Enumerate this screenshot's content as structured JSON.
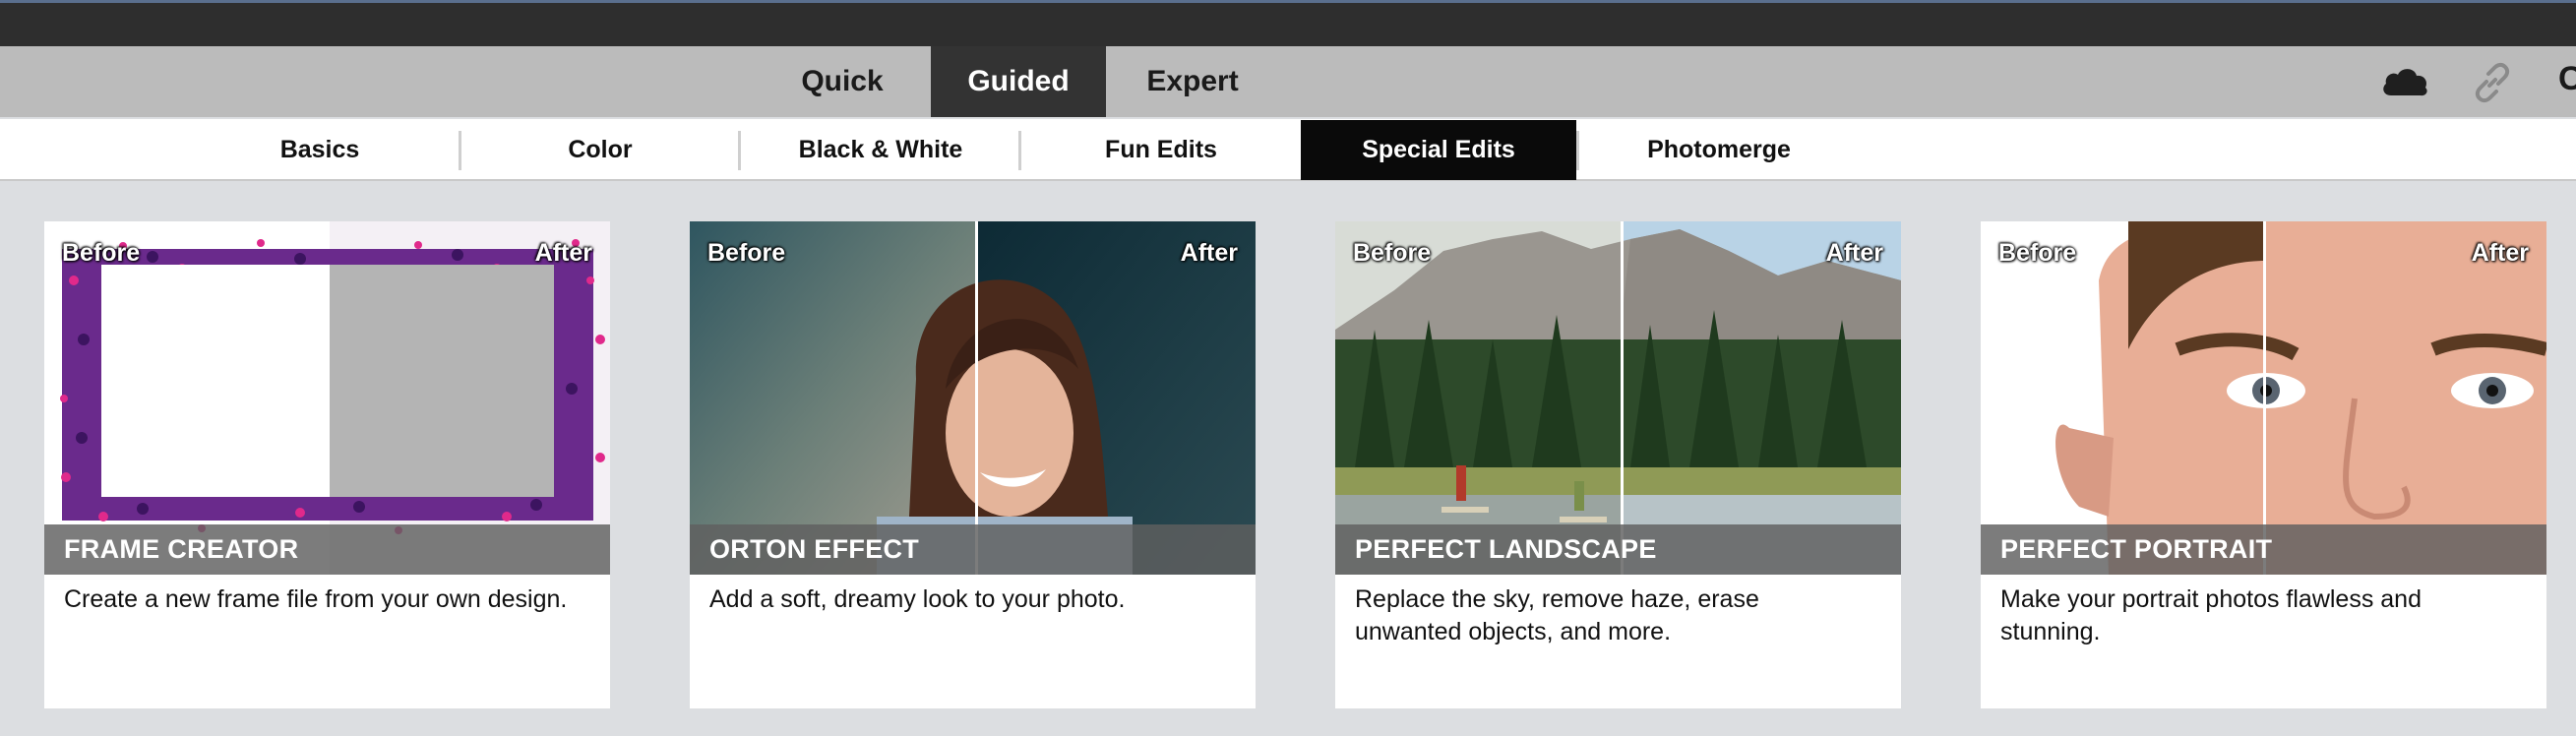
{
  "mode_tabs": {
    "quick": "Quick",
    "guided": "Guided",
    "expert": "Expert",
    "active": "Guided"
  },
  "header_icons": [
    "cloud-icon",
    "link-icon"
  ],
  "header_edge_glyph": "C",
  "category_tabs": {
    "basics": "Basics",
    "color": "Color",
    "black_white": "Black & White",
    "fun_edits": "Fun Edits",
    "special_edits": "Special Edits",
    "photomerge": "Photomerge",
    "active": "Special Edits"
  },
  "before_label": "Before",
  "after_label": "After",
  "cards": [
    {
      "title": "FRAME CREATOR",
      "description": "Create a new frame file from your own design."
    },
    {
      "title": "ORTON EFFECT",
      "description": "Add a soft, dreamy look to your photo."
    },
    {
      "title": "PERFECT LANDSCAPE",
      "description": "Replace the sky, remove haze, erase unwanted objects, and more."
    },
    {
      "title": "PERFECT PORTRAIT",
      "description": "Make your portrait photos flawless and stunning."
    }
  ],
  "colors": {
    "active_mode_bg": "#333333",
    "active_category_bg": "#0a0a0a",
    "title_bar_bg": "#2e2e2e",
    "page_bg": "#dcdee1"
  }
}
